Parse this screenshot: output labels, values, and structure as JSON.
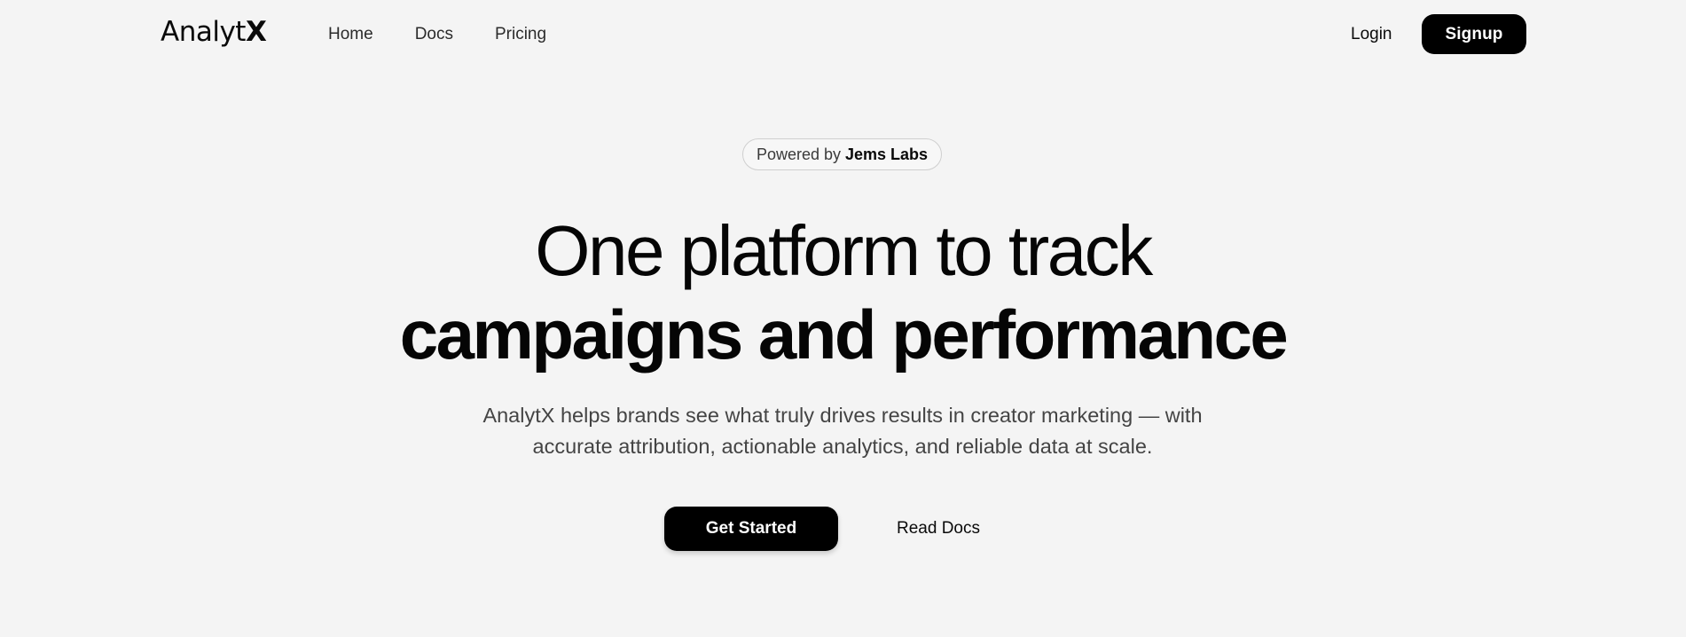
{
  "nav": {
    "logo_main": "Analyt",
    "logo_accent": "X",
    "links": [
      "Home",
      "Docs",
      "Pricing"
    ],
    "login_label": "Login",
    "signup_label": "Signup"
  },
  "hero": {
    "badge_prefix": "Powered by",
    "badge_brand": "Jems Labs",
    "headline_line1": "One platform to track",
    "headline_line2": "campaigns and performance",
    "subtext_line1": "AnalytX helps brands see what truly drives results in creator marketing — with",
    "subtext_line2": "accurate attribution, actionable analytics, and reliable data at scale.",
    "primary_cta": "Get Started",
    "secondary_cta": "Read Docs"
  },
  "colors": {
    "background": "#f4f4f4",
    "primary_button": "#000000",
    "primary_button_text": "#ffffff",
    "text": "#0a0a0a"
  }
}
